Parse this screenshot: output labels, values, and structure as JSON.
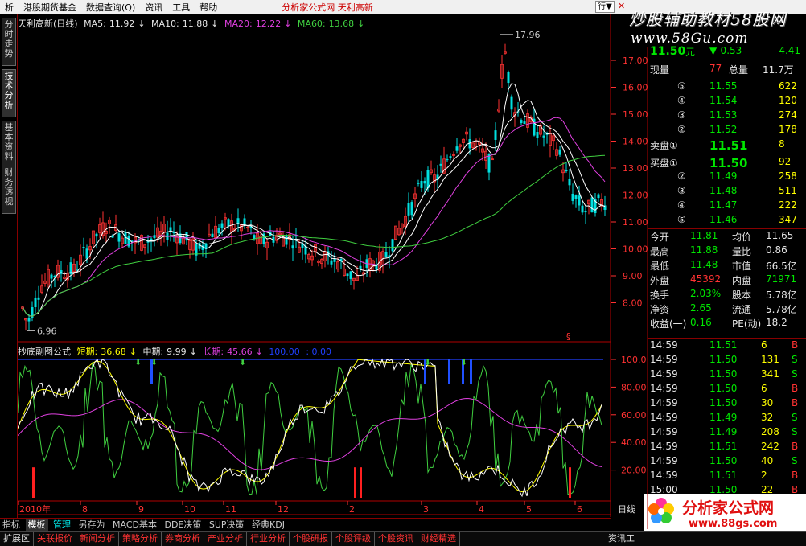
{
  "menubar": {
    "items": [
      "析",
      "港股期货基金",
      "数据查询(Q)",
      "资讯",
      "工具",
      "帮助"
    ],
    "title": "分析家公式网 天利高新",
    "search": "行▼",
    "close": "✕"
  },
  "watermark": {
    "line1": "炒股辅助教材58股网",
    "line2": "www.58Gu.com"
  },
  "lefttabs": [
    "分时走势",
    "技术分析",
    "基本资料",
    "财务透视"
  ],
  "main": {
    "stock": "天利高新(日线)",
    "ma": [
      {
        "label": "MA5:",
        "value": "11.92",
        "color": "#ffffff"
      },
      {
        "label": "MA10:",
        "value": "11.88",
        "color": "#ffffff"
      },
      {
        "label": "MA20:",
        "value": "12.22",
        "color": "#e040e0"
      },
      {
        "label": "MA60:",
        "value": "13.68",
        "color": "#40d040"
      }
    ],
    "high_label": "17.96",
    "low_label": "6.96",
    "ylabels": [
      "17.00",
      "16.00",
      "15.00",
      "14.00",
      "13.00",
      "12.00",
      "11.00",
      "10.00",
      "9.00",
      "8.00"
    ],
    "marker": "§"
  },
  "sub": {
    "name": "抄底副图公式",
    "items": [
      {
        "label": "短期:",
        "value": "36.68",
        "color": "#ffff00"
      },
      {
        "label": "中期:",
        "value": "9.99",
        "color": "#ffffff"
      },
      {
        "label": "长期:",
        "value": "45.66",
        "color": "#e040e0"
      },
      {
        "label": "100.00",
        "value": ": 0.00",
        "color": "#2040ff"
      }
    ],
    "ylabels": [
      "100.0",
      "80.00",
      "60.00",
      "40.00",
      "20.00"
    ]
  },
  "xaxis": {
    "labels": [
      "2010年",
      "8",
      "9",
      "10",
      "11",
      "12",
      "2",
      "3",
      "4",
      "5",
      "6"
    ],
    "period": "日线"
  },
  "quote": {
    "price": "11.50",
    "unit": "元",
    "change": "▼-0.53",
    "pct": "-4.41",
    "xianliang_label": "现量",
    "xianliang": "77",
    "zongliang_label": "总量",
    "zongliang": "11.7万",
    "sell": [
      {
        "n": "⑤",
        "p": "11.55",
        "v": "622"
      },
      {
        "n": "④",
        "p": "11.54",
        "v": "120"
      },
      {
        "n": "③",
        "p": "11.53",
        "v": "274"
      },
      {
        "n": "②",
        "p": "11.52",
        "v": "178"
      },
      {
        "n": "卖盘①",
        "p": "11.51",
        "v": "8"
      }
    ],
    "buy": [
      {
        "n": "买盘①",
        "p": "11.50",
        "v": "92"
      },
      {
        "n": "②",
        "p": "11.49",
        "v": "258"
      },
      {
        "n": "③",
        "p": "11.48",
        "v": "511"
      },
      {
        "n": "④",
        "p": "11.47",
        "v": "222"
      },
      {
        "n": "⑤",
        "p": "11.46",
        "v": "347"
      }
    ],
    "stats": [
      {
        "k1": "今开",
        "v1": "11.81",
        "k2": "均价",
        "v2": "11.65"
      },
      {
        "k1": "最高",
        "v1": "11.88",
        "k2": "量比",
        "v2": "0.86"
      },
      {
        "k1": "最低",
        "v1": "11.48",
        "k2": "市值",
        "v2": "66.5亿"
      },
      {
        "k1": "外盘",
        "v1": "45392",
        "k2": "内盘",
        "v2": "71971"
      },
      {
        "k1": "换手",
        "v1": "2.03%",
        "k2": "股本",
        "v2": "5.78亿"
      },
      {
        "k1": "净资",
        "v1": "2.65",
        "k2": "流通",
        "v2": "5.78亿"
      },
      {
        "k1": "收益(一)",
        "v1": "0.16",
        "k2": "PE(动)",
        "v2": "18.2"
      }
    ],
    "ticks": [
      {
        "t": "14:59",
        "p": "11.51",
        "v": "6",
        "s": "B"
      },
      {
        "t": "14:59",
        "p": "11.50",
        "v": "131",
        "s": "S"
      },
      {
        "t": "14:59",
        "p": "11.50",
        "v": "341",
        "s": "S"
      },
      {
        "t": "14:59",
        "p": "11.50",
        "v": "6",
        "s": "B"
      },
      {
        "t": "14:59",
        "p": "11.50",
        "v": "30",
        "s": "B"
      },
      {
        "t": "14:59",
        "p": "11.49",
        "v": "32",
        "s": "S"
      },
      {
        "t": "14:59",
        "p": "11.49",
        "v": "208",
        "s": "S"
      },
      {
        "t": "14:59",
        "p": "11.51",
        "v": "242",
        "s": "B"
      },
      {
        "t": "14:59",
        "p": "11.50",
        "v": "40",
        "s": "S"
      },
      {
        "t": "14:59",
        "p": "11.51",
        "v": "2",
        "s": "B"
      },
      {
        "t": "15:00",
        "p": "11.50",
        "v": "22",
        "s": "B"
      }
    ]
  },
  "bottomtabs": [
    "指标",
    "模板",
    "管理",
    "另存为",
    "MACD基本",
    "DDE决策",
    "SUP决策",
    "经典KDJ"
  ],
  "statusbar": [
    "扩展区",
    "关联报价",
    "新闻分析",
    "策略分析",
    "券商分析",
    "产业分析",
    "行业分析",
    "个股研报",
    "个股评级",
    "个股资讯",
    "财经精选",
    "资讯工"
  ],
  "logo": {
    "name": "分析家公式网",
    "url": "www.88gs.com"
  }
}
